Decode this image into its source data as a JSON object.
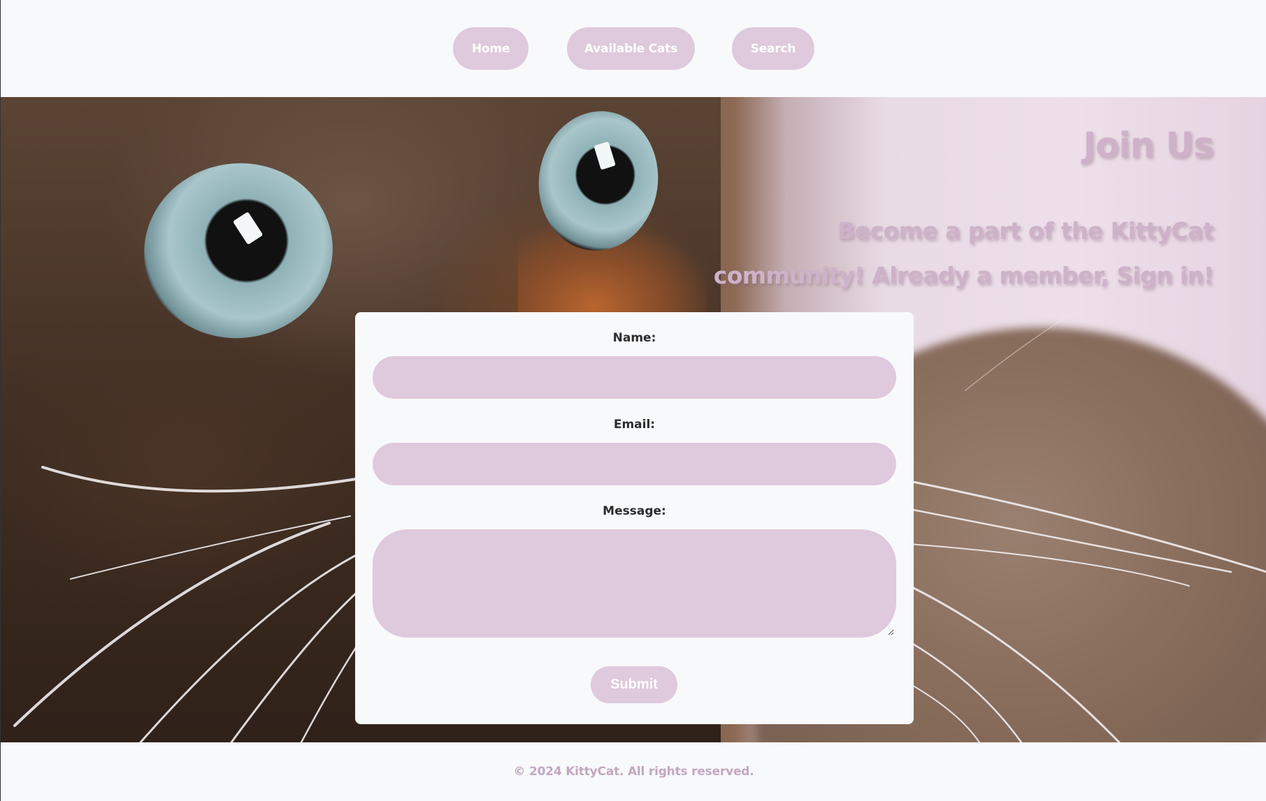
{
  "nav": {
    "items": [
      {
        "label": "Home"
      },
      {
        "label": "Available Cats"
      },
      {
        "label": "Search"
      }
    ]
  },
  "hero": {
    "title": "Join Us",
    "subtitle": "Become a part of the KittyCat community! Already a member, Sign in!"
  },
  "form": {
    "name_label": "Name:",
    "name_value": "",
    "email_label": "Email:",
    "email_value": "",
    "message_label": "Message:",
    "message_value": "",
    "submit_label": "Submit"
  },
  "footer": {
    "copyright": "© 2024 KittyCat. All rights reserved."
  },
  "colors": {
    "accent": "#dfc9dd",
    "heading": "#cdb2c9",
    "footer_text": "#c3a7c0",
    "background": "#f8f9fb"
  }
}
